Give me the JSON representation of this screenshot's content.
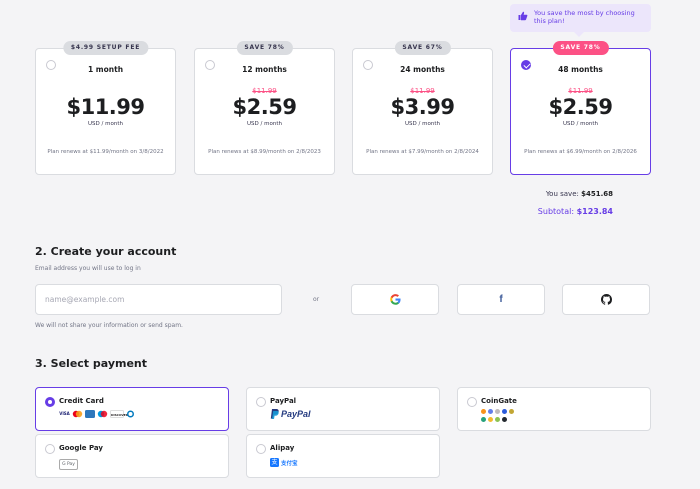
{
  "tooltip": {
    "text": "You save the most by choosing this plan!",
    "icon": "thumbs-up-icon"
  },
  "plans": [
    {
      "badge": "$4.99 SETUP FEE",
      "term": "1 month",
      "old_price": "",
      "price": "$11.99",
      "unit": "USD / month",
      "renew": "Plan renews at $11.99/month on 3/8/2022",
      "selected": false
    },
    {
      "badge": "SAVE 78%",
      "term": "12 months",
      "old_price": "$11.99",
      "price": "$2.59",
      "unit": "USD / month",
      "renew": "Plan renews at $8.99/month on 2/8/2023",
      "selected": false
    },
    {
      "badge": "SAVE 67%",
      "term": "24 months",
      "old_price": "$11.99",
      "price": "$3.99",
      "unit": "USD / month",
      "renew": "Plan renews at $7.99/month on 2/8/2024",
      "selected": false
    },
    {
      "badge": "SAVE 78%",
      "term": "48 months",
      "old_price": "$11.99",
      "price": "$2.59",
      "unit": "USD / month",
      "renew": "Plan renews at $6.99/month on 2/8/2026",
      "selected": true
    }
  ],
  "summary": {
    "save_label": "You save:",
    "save_value": "$451.68",
    "subtotal_label": "Subtotal:",
    "subtotal_value": "$123.84"
  },
  "account": {
    "heading": "2. Create your account",
    "email_label": "Email address you will use to log in",
    "email_placeholder": "name@example.com",
    "email_value": "",
    "or_text": "or",
    "privacy_note": "We will not share your information or send spam.",
    "social": [
      "google-icon",
      "facebook-icon",
      "github-icon"
    ]
  },
  "payment": {
    "heading": "3. Select payment",
    "methods": [
      {
        "name": "Credit Card",
        "selected": true
      },
      {
        "name": "PayPal",
        "selected": false,
        "logo_text": "PayPal"
      },
      {
        "name": "CoinGate",
        "selected": false
      },
      {
        "name": "Google Pay",
        "selected": false,
        "logo_text": "G Pay"
      },
      {
        "name": "Alipay",
        "selected": false,
        "logo_text": "支付宝"
      }
    ],
    "card_logos": [
      "VISA",
      "mastercard",
      "AMEX",
      "maestro",
      "DISCOVER",
      "diners"
    ]
  },
  "colors": {
    "accent": "#673de6",
    "hot": "#fc5185",
    "text": "#1d1e20",
    "muted": "#727586",
    "paypal_blue": "#253b80",
    "paypal_light": "#179bd7"
  }
}
